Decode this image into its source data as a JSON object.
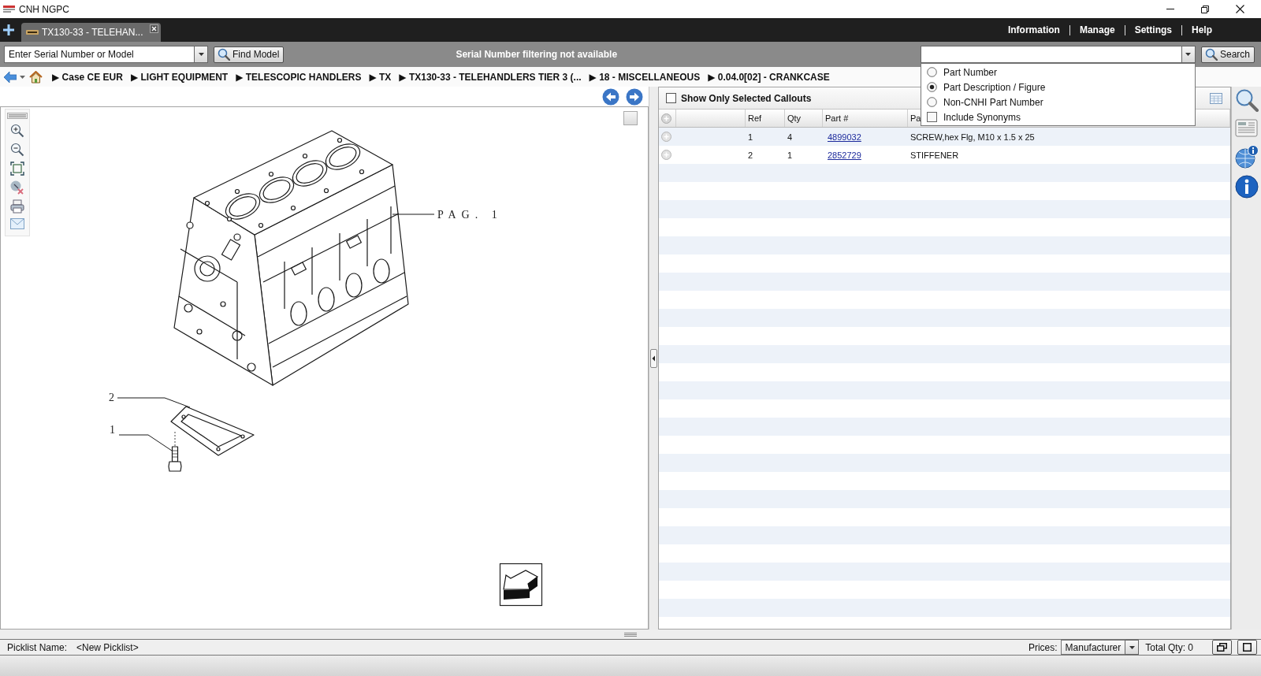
{
  "window": {
    "title": "CNH NGPC"
  },
  "tabs": [
    {
      "label": "TX130-33 - TELEHAN...",
      "selected": true
    }
  ],
  "menu": [
    {
      "label": "Information"
    },
    {
      "label": "Manage"
    },
    {
      "label": "Settings"
    },
    {
      "label": "Help"
    }
  ],
  "toolbar": {
    "serial_field": {
      "placeholder": "Enter Serial Number or Model"
    },
    "find_button": "Find Model",
    "notice": "Serial Number filtering not available",
    "search_button": "Search"
  },
  "search_dropdown": {
    "expanded": true,
    "modes": [
      {
        "label": "Part Number",
        "selected": false
      },
      {
        "label": "Part Description / Figure",
        "selected": true
      },
      {
        "label": "Non-CNHI Part Number",
        "selected": false
      }
    ],
    "synonyms": {
      "label": "Include Synonyms",
      "checked": false
    }
  },
  "breadcrumb": [
    {
      "label": "▶ Case CE EUR"
    },
    {
      "label": "▶ LIGHT EQUIPMENT"
    },
    {
      "label": "▶ TELESCOPIC HANDLERS"
    },
    {
      "label": "▶ TX"
    },
    {
      "label": "▶ TX130-33 - TELEHANDLERS TIER 3 (..."
    },
    {
      "label": "▶ 18 - MISCELLANEOUS"
    },
    {
      "label": "▶ 0.04.0[02] - CRANKCASE"
    }
  ],
  "diagram": {
    "callouts": [
      {
        "label": "PAG. 1"
      },
      {
        "label": "2"
      },
      {
        "label": "1"
      }
    ]
  },
  "callout_filter": {
    "label": "Show Only Selected Callouts",
    "checked": false
  },
  "table": {
    "columns": [
      "Ref",
      "Qty",
      "Part #",
      "Pa"
    ],
    "rows": [
      {
        "ref": "1",
        "qty": "4",
        "part_number": "4899032",
        "description": "SCREW,hex Flg, M10 x 1.5 x 25"
      },
      {
        "ref": "2",
        "qty": "1",
        "part_number": "2852729",
        "description": "STIFFENER"
      }
    ]
  },
  "picklist": {
    "label": "Picklist Name:",
    "value": "<New Picklist>"
  },
  "prices": {
    "label": "Prices:",
    "value": "Manufacturer"
  },
  "total_qty": "Total Qty: 0"
}
